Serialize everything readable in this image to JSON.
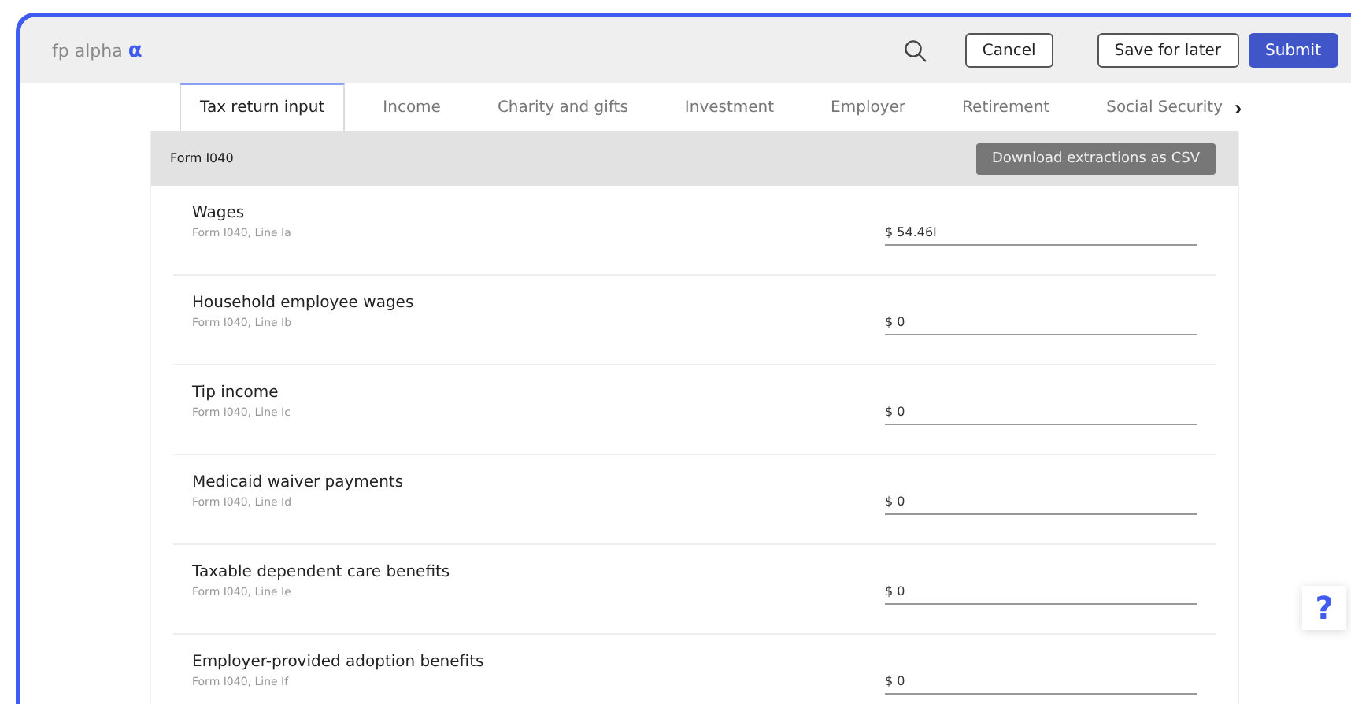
{
  "logo": {
    "text": "fp alpha",
    "mark": "α"
  },
  "header_buttons": [
    {
      "label": "Cancel",
      "kind": "outline"
    },
    {
      "label": "Save for later",
      "kind": "outline"
    },
    {
      "label": "Submit",
      "kind": "primary"
    }
  ],
  "tabs": [
    {
      "label": "Tax return input",
      "selected": true
    },
    {
      "label": "Income",
      "selected": false
    },
    {
      "label": "Charity and gifts",
      "selected": false
    },
    {
      "label": "Investment",
      "selected": false
    },
    {
      "label": "Employer",
      "selected": false
    },
    {
      "label": "Retirement",
      "selected": false
    },
    {
      "label": "Social Security",
      "selected": false
    }
  ],
  "tab_scroll": "›",
  "form": {
    "title": "Form I040",
    "download_button": "Download extractions as CSV",
    "rows": [
      {
        "label": "Wages",
        "line": "Form I040, Line Ia",
        "value": "$ 54.46I"
      },
      {
        "label": "Household employee wages",
        "line": "Form I040, Line Ib",
        "value": "$ 0"
      },
      {
        "label": "Tip income",
        "line": "Form I040, Line Ic",
        "value": "$ 0"
      },
      {
        "label": "Medicaid waiver payments",
        "line": "Form I040, Line Id",
        "value": "$ 0"
      },
      {
        "label": "Taxable dependent care benefits",
        "line": "Form I040, Line Ie",
        "value": "$ 0"
      },
      {
        "label": "Employer-provided adoption benefits",
        "line": "Form I040, Line If",
        "value": "$ 0"
      }
    ]
  },
  "help_button": "?"
}
